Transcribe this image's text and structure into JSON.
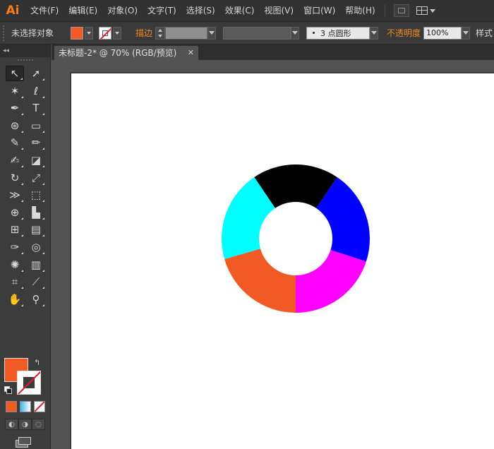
{
  "app": {
    "logo": "Ai",
    "menus": [
      "文件(F)",
      "编辑(E)",
      "对象(O)",
      "文字(T)",
      "选择(S)",
      "效果(C)",
      "视图(V)",
      "窗口(W)",
      "帮助(H)"
    ]
  },
  "control_bar": {
    "selection_status": "未选择对象",
    "fill_color": "#f15a24",
    "stroke_label": "描边",
    "brush_value": "3 点圆形",
    "opacity_label": "不透明度",
    "opacity_value": "100%",
    "style_label": "样式"
  },
  "tools_panel": {
    "collapse_glyph": "◂◂",
    "tools": [
      {
        "name": "selection-tool-icon",
        "glyph": "↖",
        "active": true
      },
      {
        "name": "direct-selection-tool-icon",
        "glyph": "➚"
      },
      {
        "name": "magic-wand-tool-icon",
        "glyph": "✶"
      },
      {
        "name": "lasso-tool-icon",
        "glyph": "ℓ"
      },
      {
        "name": "pen-tool-icon",
        "glyph": "✒"
      },
      {
        "name": "type-tool-icon",
        "glyph": "T"
      },
      {
        "name": "spiral-tool-icon",
        "glyph": "⊛"
      },
      {
        "name": "rectangle-tool-icon",
        "glyph": "▭"
      },
      {
        "name": "paintbrush-tool-icon",
        "glyph": "✎"
      },
      {
        "name": "pencil-tool-icon",
        "glyph": "✏"
      },
      {
        "name": "blob-brush-tool-icon",
        "glyph": "✍"
      },
      {
        "name": "eraser-tool-icon",
        "glyph": "◪"
      },
      {
        "name": "rotate-tool-icon",
        "glyph": "↻"
      },
      {
        "name": "scale-tool-icon",
        "glyph": "⤢"
      },
      {
        "name": "width-tool-icon",
        "glyph": "≫"
      },
      {
        "name": "free-transform-tool-icon",
        "glyph": "⬚"
      },
      {
        "name": "shape-builder-tool-icon",
        "glyph": "⊕"
      },
      {
        "name": "perspective-grid-tool-icon",
        "glyph": "▙"
      },
      {
        "name": "mesh-tool-icon",
        "glyph": "⊞"
      },
      {
        "name": "gradient-tool-icon",
        "glyph": "▤"
      },
      {
        "name": "eyedropper-tool-icon",
        "glyph": "✑"
      },
      {
        "name": "blend-tool-icon",
        "glyph": "◎"
      },
      {
        "name": "symbol-sprayer-tool-icon",
        "glyph": "✺"
      },
      {
        "name": "column-graph-tool-icon",
        "glyph": "▥"
      },
      {
        "name": "artboard-tool-icon",
        "glyph": "⌗"
      },
      {
        "name": "slice-tool-icon",
        "glyph": "⟋"
      },
      {
        "name": "hand-tool-icon",
        "glyph": "✋"
      },
      {
        "name": "zoom-tool-icon",
        "glyph": "⚲"
      }
    ],
    "fill_color": "#f15a24",
    "swap_glyph": "↰"
  },
  "document": {
    "tab_title": "未标题-2* @ 70% (RGB/预览)",
    "tab_close": "✕"
  },
  "artwork": {
    "description_colors": [
      "#000000",
      "#0000ff",
      "#ff00ff",
      "#f15a24",
      "#00ffff"
    ],
    "segments": [
      {
        "color": "#000000",
        "start": -34,
        "end": 34
      },
      {
        "color": "#0000ff",
        "start": 34,
        "end": 108
      },
      {
        "color": "#ff00ff",
        "start": 108,
        "end": 180
      },
      {
        "color": "#f15a24",
        "start": 180,
        "end": 254
      },
      {
        "color": "#00ffff",
        "start": 254,
        "end": 326
      }
    ]
  }
}
